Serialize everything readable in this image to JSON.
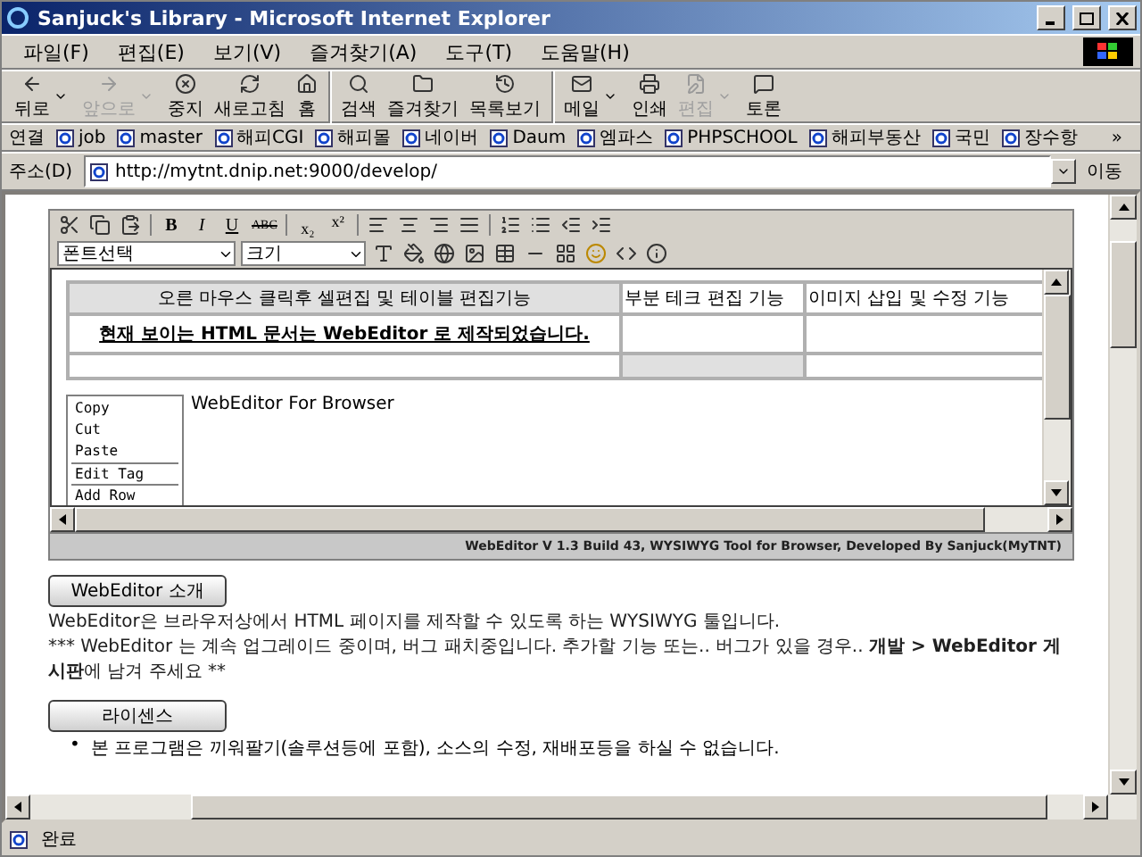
{
  "window": {
    "title": "Sanjuck's Library - Microsoft Internet Explorer"
  },
  "menu": [
    "파일(F)",
    "편집(E)",
    "보기(V)",
    "즐겨찾기(A)",
    "도구(T)",
    "도움말(H)"
  ],
  "toolbar": [
    {
      "label": "뒤로",
      "disabled": false,
      "dropdown": true,
      "group_start": false
    },
    {
      "label": "앞으로",
      "disabled": true,
      "dropdown": true,
      "group_start": false
    },
    {
      "label": "중지",
      "disabled": false,
      "dropdown": false,
      "group_start": false
    },
    {
      "label": "새로고침",
      "disabled": false,
      "dropdown": false,
      "group_start": false
    },
    {
      "label": "홈",
      "disabled": false,
      "dropdown": false,
      "group_start": false
    },
    {
      "label": "검색",
      "disabled": false,
      "dropdown": false,
      "group_start": true
    },
    {
      "label": "즐겨찾기",
      "disabled": false,
      "dropdown": false,
      "group_start": false
    },
    {
      "label": "목록보기",
      "disabled": false,
      "dropdown": false,
      "group_start": false
    },
    {
      "label": "메일",
      "disabled": false,
      "dropdown": true,
      "group_start": true
    },
    {
      "label": "인쇄",
      "disabled": false,
      "dropdown": false,
      "group_start": false
    },
    {
      "label": "편집",
      "disabled": true,
      "dropdown": true,
      "group_start": false
    },
    {
      "label": "토론",
      "disabled": false,
      "dropdown": false,
      "group_start": false
    }
  ],
  "links": {
    "label": "연결",
    "items": [
      "job",
      "master",
      "해피CGI",
      "해피몰",
      "네이버",
      "Daum",
      "엠파스",
      "PHPSCHOOL",
      "해피부동산",
      "국민",
      "장수항"
    ],
    "more": "»"
  },
  "address": {
    "label": "주소(D)",
    "value": "http://mytnt.dnip.net:9000/develop/",
    "go": "이동"
  },
  "editor": {
    "format_buttons": [
      {
        "kind": "bold",
        "label": "B"
      },
      {
        "kind": "italic",
        "label": "I"
      },
      {
        "kind": "underline",
        "label": "U"
      },
      {
        "kind": "strike",
        "label": "ABC"
      }
    ],
    "script_buttons": [
      {
        "kind": "sub",
        "label": "x₂"
      },
      {
        "kind": "sup",
        "label": "x²"
      }
    ],
    "font_select": "폰트선택",
    "size_select": "크기",
    "table": [
      [
        {
          "text": "오른 마우스 클릭후 셀편집 및 테이블 편집기능",
          "shaded": true,
          "emphasis": false
        },
        {
          "text": "부분 테크 편집 기능",
          "shaded": false,
          "emphasis": false
        },
        {
          "text": "이미지 삽입 및 수정 기능",
          "shaded": false,
          "emphasis": false
        }
      ],
      [
        {
          "text": "현재 보이는 HTML 문서는 WebEditor 로 제작되었습니다.",
          "shaded": false,
          "emphasis": true
        },
        {
          "shaded": false
        },
        {
          "shaded": false
        }
      ],
      [
        {
          "shaded": false
        },
        {
          "shaded": true
        },
        {
          "shaded": false
        }
      ]
    ],
    "context_menu": [
      {
        "label": "Copy",
        "group_start": false
      },
      {
        "label": "Cut",
        "group_start": false
      },
      {
        "label": "Paste",
        "group_start": false
      },
      {
        "label": "Edit Tag",
        "group_start": true
      },
      {
        "label": "Add Row",
        "group_start": true
      }
    ],
    "body_text": "WebEditor For Browser",
    "credit": "WebEditor V 1.3 Build 43, WYSIWYG Tool for Browser, Developed By Sanjuck(MyTNT)"
  },
  "sections": [
    {
      "heading": "WebEditor 소개",
      "kind": "paragraphs",
      "paragraphs": [
        [
          {
            "text": "WebEditor은 브라우저상에서 HTML 페이지를 제작할 수 있도록 하는 WYSIWYG 툴입니다.",
            "bold": false
          }
        ],
        [
          {
            "text": "*** WebEditor 는 계속 업그레이드 중이며, 버그 패치중입니다. 추가할 기능 또는.. 버그가 있을 경우.. ",
            "bold": false
          },
          {
            "text": "개발 > WebEditor 게시판",
            "bold": true
          },
          {
            "text": "에 남겨 주세요 **",
            "bold": false
          }
        ]
      ]
    },
    {
      "heading": "라이센스",
      "kind": "bullets",
      "bullet": "•",
      "paragraphs": [
        [
          {
            "text": "본 프로그램은 끼워팔기(솔루션등에 포함), 소스의 수정, 재배포등을 하실 수 없습니다.",
            "bold": false
          }
        ]
      ]
    }
  ],
  "status_bar": {
    "text": "완료"
  }
}
